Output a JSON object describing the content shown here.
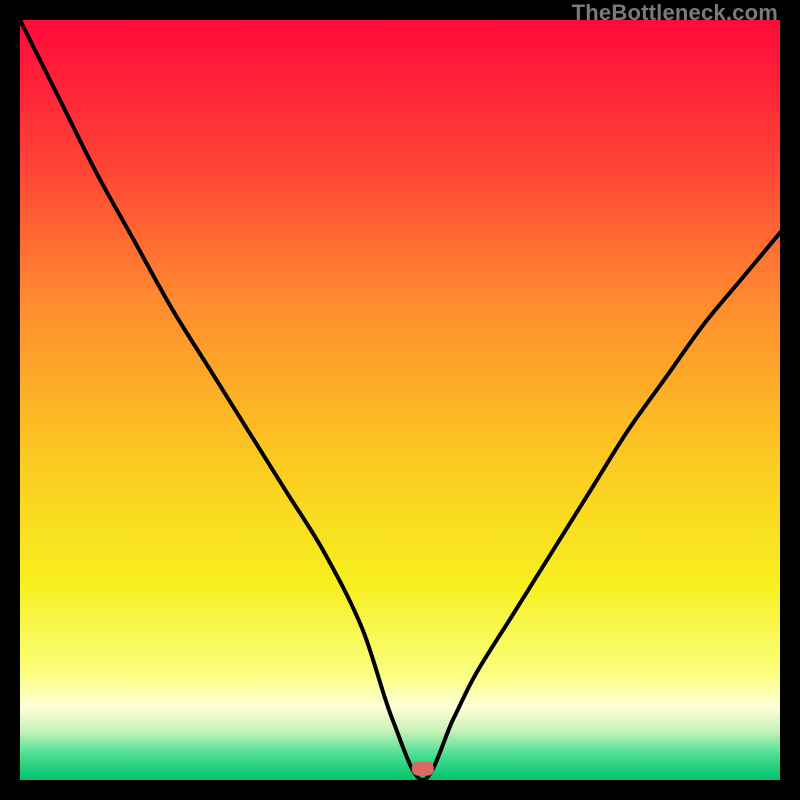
{
  "watermark": "TheBottleneck.com",
  "chart_data": {
    "type": "line",
    "title": "",
    "xlabel": "",
    "ylabel": "",
    "xlim": [
      0,
      100
    ],
    "ylim": [
      0,
      100
    ],
    "optimum_x": 53,
    "marker": {
      "x": 53,
      "y": 1.5,
      "color": "#d86a63"
    },
    "series": [
      {
        "name": "bottleneck-curve",
        "x": [
          0,
          5,
          10,
          15,
          20,
          25,
          30,
          35,
          40,
          45,
          49,
          53,
          57,
          60,
          65,
          70,
          75,
          80,
          85,
          90,
          95,
          100
        ],
        "y": [
          100,
          90,
          80,
          71,
          62,
          54,
          46,
          38,
          30,
          20,
          8,
          0,
          8,
          14,
          22,
          30,
          38,
          46,
          53,
          60,
          66,
          72
        ]
      }
    ],
    "background_gradient": {
      "stops": [
        {
          "pos": 0.0,
          "color": "#ff0a3a"
        },
        {
          "pos": 0.18,
          "color": "#ff3f36"
        },
        {
          "pos": 0.38,
          "color": "#fe8e2f"
        },
        {
          "pos": 0.58,
          "color": "#fbca21"
        },
        {
          "pos": 0.74,
          "color": "#f7ef1f"
        },
        {
          "pos": 0.86,
          "color": "#faff7d"
        },
        {
          "pos": 0.905,
          "color": "#fdffd8"
        },
        {
          "pos": 0.935,
          "color": "#c9f3b9"
        },
        {
          "pos": 0.965,
          "color": "#4fdf95"
        },
        {
          "pos": 1.0,
          "color": "#00c36b"
        }
      ]
    }
  }
}
